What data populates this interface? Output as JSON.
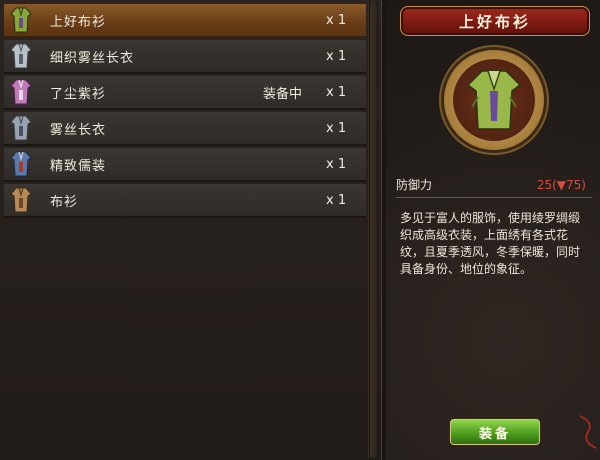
{
  "inventory": {
    "items": [
      {
        "name": "上好布衫",
        "status": "",
        "qty": "x 1",
        "icon": "robe-green-icon",
        "color": "#8aa83a"
      },
      {
        "name": "细织雾丝长衣",
        "status": "",
        "qty": "x 1",
        "icon": "robe-silver-icon",
        "color": "#b8c0c8"
      },
      {
        "name": "了尘紫衫",
        "status": "装备中",
        "qty": "x 1",
        "icon": "robe-purple-icon",
        "color": "#c07ab8"
      },
      {
        "name": "雾丝长衣",
        "status": "",
        "qty": "x 1",
        "icon": "robe-grey-icon",
        "color": "#9aa4b0"
      },
      {
        "name": "精致儒装",
        "status": "",
        "qty": "x 1",
        "icon": "robe-scholar-icon",
        "color": "#5a78a8"
      },
      {
        "name": "布衫",
        "status": "",
        "qty": "x 1",
        "icon": "robe-tan-icon",
        "color": "#b48a5a"
      }
    ],
    "selected_index": 0
  },
  "detail": {
    "title": "上好布衫",
    "portrait_icon": "robe-green-icon",
    "stat": {
      "label": "防御力",
      "value": "25(▼75)"
    },
    "description": "多见于富人的服饰，使用绫罗绸缎织成高级衣装，上面绣有各式花纹，且夏季透风，冬季保暖，同时具备身份、地位的象征。",
    "equip_label": "装备"
  },
  "colors": {
    "selected_row": "#7a4a1f",
    "stat_value": "#d94a3a",
    "title_banner": "#8a2216",
    "equip_button": "#5aa82a"
  }
}
